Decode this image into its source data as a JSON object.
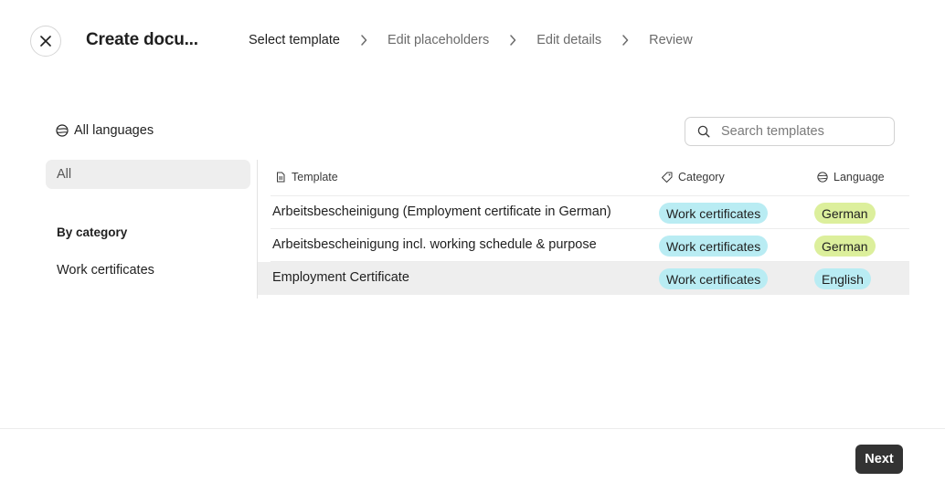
{
  "header": {
    "title": "Create docu...",
    "steps": [
      {
        "label": "Select template",
        "active": true
      },
      {
        "label": "Edit placeholders",
        "active": false
      },
      {
        "label": "Edit details",
        "active": false
      },
      {
        "label": "Review",
        "active": false
      }
    ]
  },
  "filters": {
    "language_label": "All languages",
    "search_placeholder": "Search templates"
  },
  "sidebar": {
    "all_label": "All",
    "category_heading": "By category",
    "categories": [
      "Work certificates"
    ]
  },
  "table": {
    "columns": {
      "template": "Template",
      "category": "Category",
      "language": "Language"
    },
    "rows": [
      {
        "name": "Arbeitsbescheinigung (Employment certificate in German)",
        "category": "Work certificates",
        "language": "German",
        "selected": false
      },
      {
        "name": "Arbeitsbescheinigung incl. working schedule & purpose",
        "category": "Work certificates",
        "language": "German",
        "selected": false
      },
      {
        "name": "Employment Certificate",
        "category": "Work certificates",
        "language": "English",
        "selected": true
      }
    ]
  },
  "colors": {
    "category_badge": "#b9ecf3",
    "german_badge": "#dcef9c",
    "english_badge": "#b9ecf3",
    "selected_row": "#eeeeee",
    "primary_button": "#333333"
  },
  "footer": {
    "next_label": "Next"
  }
}
